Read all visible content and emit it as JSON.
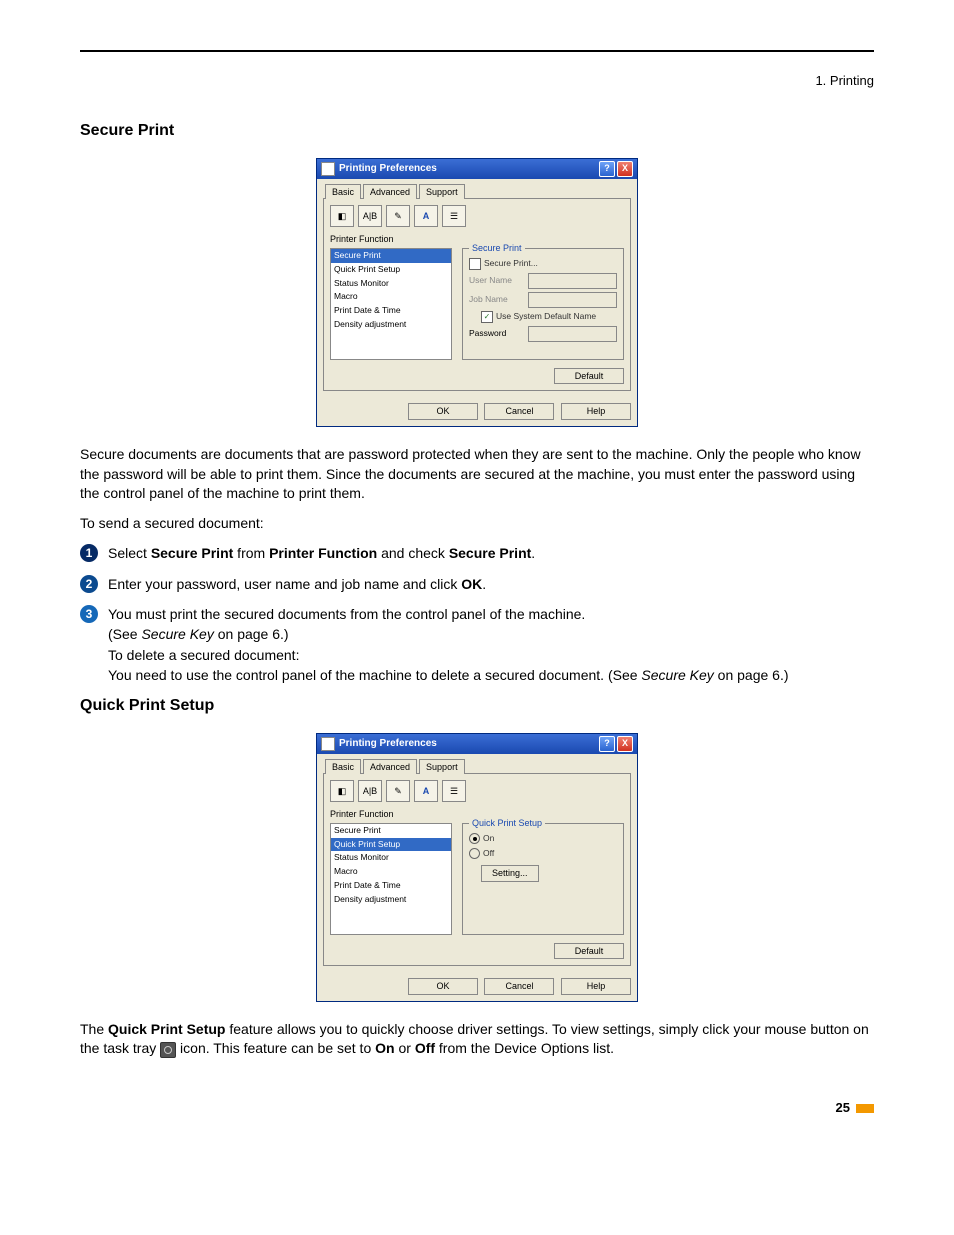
{
  "header": {
    "breadcrumb": "1. Printing"
  },
  "sections": {
    "secure_print": {
      "title": "Secure Print"
    },
    "quick_print_setup": {
      "title": "Quick Print Setup"
    }
  },
  "dialog": {
    "title": "Printing Preferences",
    "tabs": {
      "basic": "Basic",
      "advanced": "Advanced",
      "support": "Support"
    },
    "printer_function_label": "Printer Function",
    "function_list": {
      "secure_print": "Secure Print",
      "quick_print_setup": "Quick Print Setup",
      "status_monitor": "Status Monitor",
      "macro": "Macro",
      "print_date_time": "Print Date & Time",
      "density_adjustment": "Density adjustment"
    },
    "secure_group": {
      "title": "Secure Print",
      "checkbox": "Secure Print...",
      "user_name": "User Name",
      "job_name": "Job Name",
      "use_system_default": "Use System Default Name",
      "password": "Password"
    },
    "quick_group": {
      "title": "Quick Print Setup",
      "on": "On",
      "off": "Off",
      "setting": "Setting..."
    },
    "buttons": {
      "default": "Default",
      "ok": "OK",
      "cancel": "Cancel",
      "help": "Help"
    }
  },
  "text": {
    "secure_intro": "Secure documents are documents that are password protected when they are sent to the machine. Only the people who know the password will be able to print them. Since the documents are secured at the machine, you must enter the password using the control panel of the machine to print them.",
    "to_send": "To send a secured document:",
    "step1_a": "Select ",
    "step1_b": "Secure Print",
    "step1_c": " from ",
    "step1_d": "Printer Function",
    "step1_e": " and check ",
    "step1_f": "Secure Print",
    "step1_g": ".",
    "step2_a": "Enter your password, user name and job name and click ",
    "step2_b": "OK",
    "step2_c": ".",
    "step3_a": "You must print the secured documents from the control panel of the machine.",
    "step3_b": "(See ",
    "step3_c": "Secure Key",
    "step3_d": " on page 6.)",
    "step3_e": "To delete a secured document:",
    "step3_f": "You need to use the control panel of the machine to delete a secured document. (See ",
    "step3_g": "Secure Key",
    "step3_h": " on page 6.)",
    "quick_a": "The ",
    "quick_b": "Quick Print Setup",
    "quick_c": " feature allows you to quickly choose driver settings. To view settings, simply click your mouse button on the task tray ",
    "quick_d": " icon. This feature can be set to ",
    "quick_e": "On",
    "quick_f": " or ",
    "quick_g": "Off",
    "quick_h": " from the Device Options list."
  },
  "page_number": "25"
}
